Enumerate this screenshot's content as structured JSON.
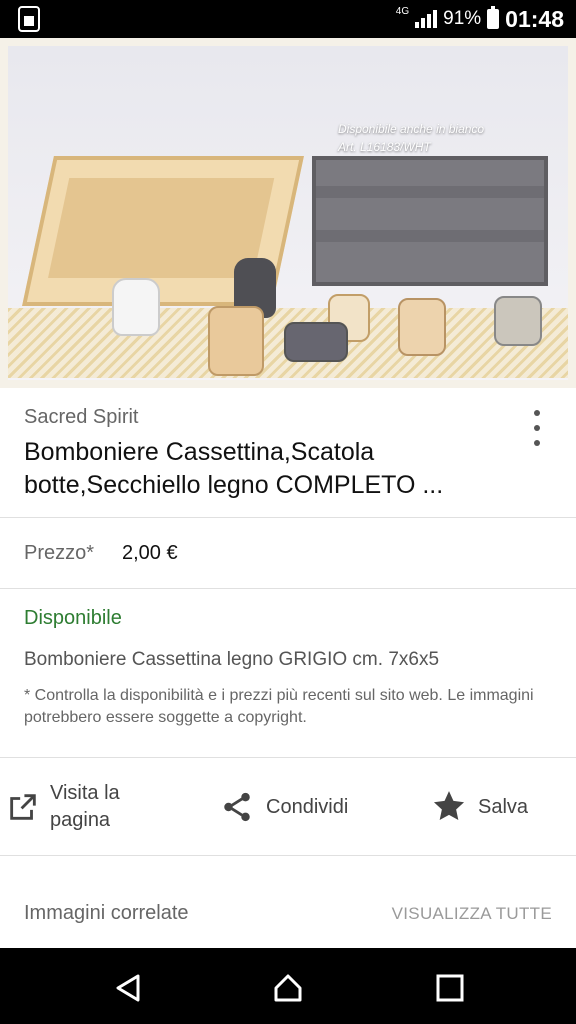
{
  "status_bar": {
    "network": "4G",
    "battery": "91%",
    "time": "01:48"
  },
  "hero": {
    "caption_line1": "Disponibile anche in bianco",
    "caption_line2": "Art. L16183/WHT"
  },
  "product": {
    "source": "Sacred Spirit",
    "title": "Bomboniere Cassettina,Scatola botte,Secchiello legno COMPLETO ..."
  },
  "price": {
    "label": "Prezzo*",
    "value": "2,00 €"
  },
  "info": {
    "availability": "Disponibile",
    "description": "Bomboniere Cassettina legno GRIGIO cm. 7x6x5",
    "disclaimer": "* Controlla la disponibilità e i prezzi più recenti sul sito web. Le immagini potrebbero essere soggette a copyright."
  },
  "actions": {
    "visit": "Visita la pagina",
    "share": "Condividi",
    "save": "Salva"
  },
  "related": {
    "title": "Immagini correlate",
    "view_all": "VISUALIZZA TUTTE"
  },
  "colors": {
    "availability_green": "#2e7d32",
    "text_primary": "#111111",
    "text_secondary": "#666666"
  }
}
